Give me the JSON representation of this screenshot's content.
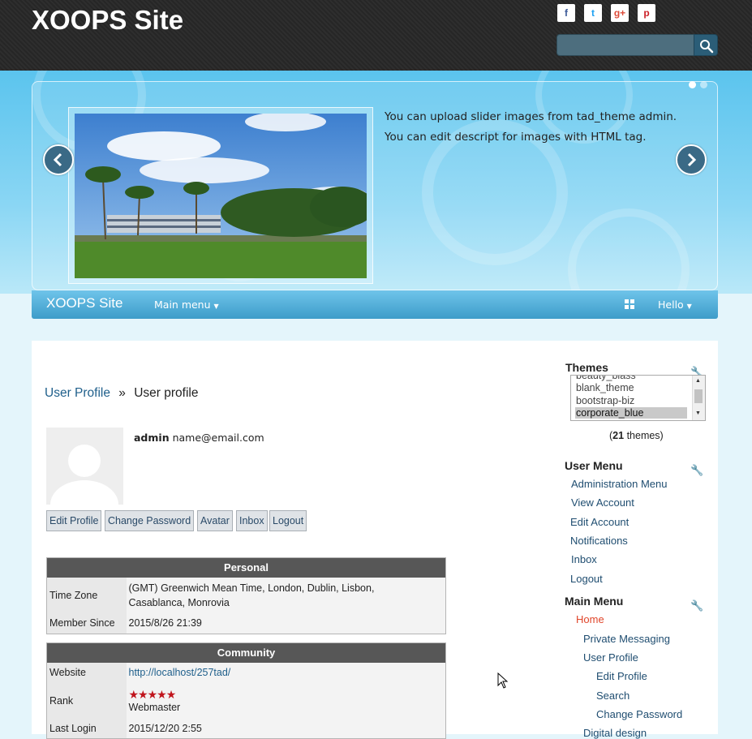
{
  "header": {
    "site_title": "XOOPS Site",
    "social": [
      {
        "name": "facebook",
        "glyph": "f",
        "color": "#3b5998"
      },
      {
        "name": "twitter",
        "glyph": "t",
        "color": "#1da1f2"
      },
      {
        "name": "google-plus",
        "glyph": "g+",
        "color": "#dd4b39"
      },
      {
        "name": "pinterest",
        "glyph": "p",
        "color": "#cb2027"
      }
    ],
    "search": {
      "value": "",
      "placeholder": ""
    }
  },
  "slider": {
    "caption_line1": "You can upload slider images from tad_theme admin.",
    "caption_line2": "You can edit descript for images with HTML tag.",
    "prev_glyph": "‹",
    "next_glyph": "›",
    "active_slide": 1,
    "slide_count": 2
  },
  "navbar": {
    "brand": "XOOPS Site",
    "main_menu": "Main menu",
    "hello": "Hello"
  },
  "breadcrumb": {
    "link": "User Profile",
    "sep": "»",
    "current": "User profile"
  },
  "profile": {
    "username": "admin",
    "email": "name@email.com",
    "buttons": [
      "Edit Profile",
      "Change Password",
      "Avatar",
      "Inbox",
      "Logout"
    ]
  },
  "personal": {
    "heading": "Personal",
    "timezone_label": "Time Zone",
    "timezone_line1": "(GMT) Greenwich Mean Time, London, Dublin, Lisbon,",
    "timezone_line2": "Casablanca, Monrovia",
    "member_since_label": "Member Since",
    "member_since": "2015/8/26 21:39"
  },
  "community": {
    "heading": "Community",
    "website_label": "Website",
    "website": "http://localhost/257tad/",
    "rank_label": "Rank",
    "rank_stars": 5,
    "rank_title": "Webmaster",
    "last_login_label": "Last Login",
    "last_login": "2015/12/20 2:55"
  },
  "themes_block": {
    "title": "Themes",
    "options": [
      "beauty_blass",
      "blank_theme",
      "bootstrap-biz",
      "corporate_blue"
    ],
    "selected": "corporate_blue",
    "count": "21",
    "count_suffix": "themes)",
    "count_prefix": "("
  },
  "user_menu": {
    "title": "User Menu",
    "items": [
      "Administration Menu",
      "View Account",
      "Edit Account",
      "Notifications",
      "Inbox",
      "Logout"
    ]
  },
  "main_menu": {
    "title": "Main Menu",
    "items": [
      "Home",
      "Private Messaging",
      "User Profile",
      "Edit Profile",
      "Search",
      "Change Password",
      "Digital design"
    ],
    "active_color": "#e0462b"
  }
}
